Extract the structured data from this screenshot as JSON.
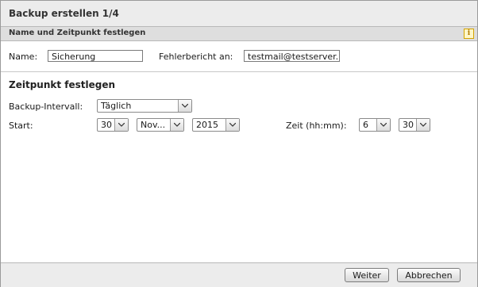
{
  "dialog": {
    "title": "Backup erstellen 1/4",
    "section_title": "Name und Zeitpunkt festlegen",
    "info_icon_glyph": "i"
  },
  "name_row": {
    "name_label": "Name:",
    "name_value": "Sicherung",
    "error_report_label": "Fehlerbericht an:",
    "error_report_value": "testmail@testserver."
  },
  "schedule": {
    "heading": "Zeitpunkt festlegen",
    "interval_label": "Backup-Intervall:",
    "interval_value": "Täglich",
    "start_label": "Start:",
    "start_day": "30",
    "start_month": "Nov...",
    "start_year": "2015",
    "time_label": "Zeit (hh:mm):",
    "time_hour": "6",
    "time_minute": "30"
  },
  "footer": {
    "next_label": "Weiter",
    "cancel_label": "Abbrechen"
  },
  "icons": {
    "info": "info-icon",
    "dropdown": "chevron-down-icon"
  }
}
